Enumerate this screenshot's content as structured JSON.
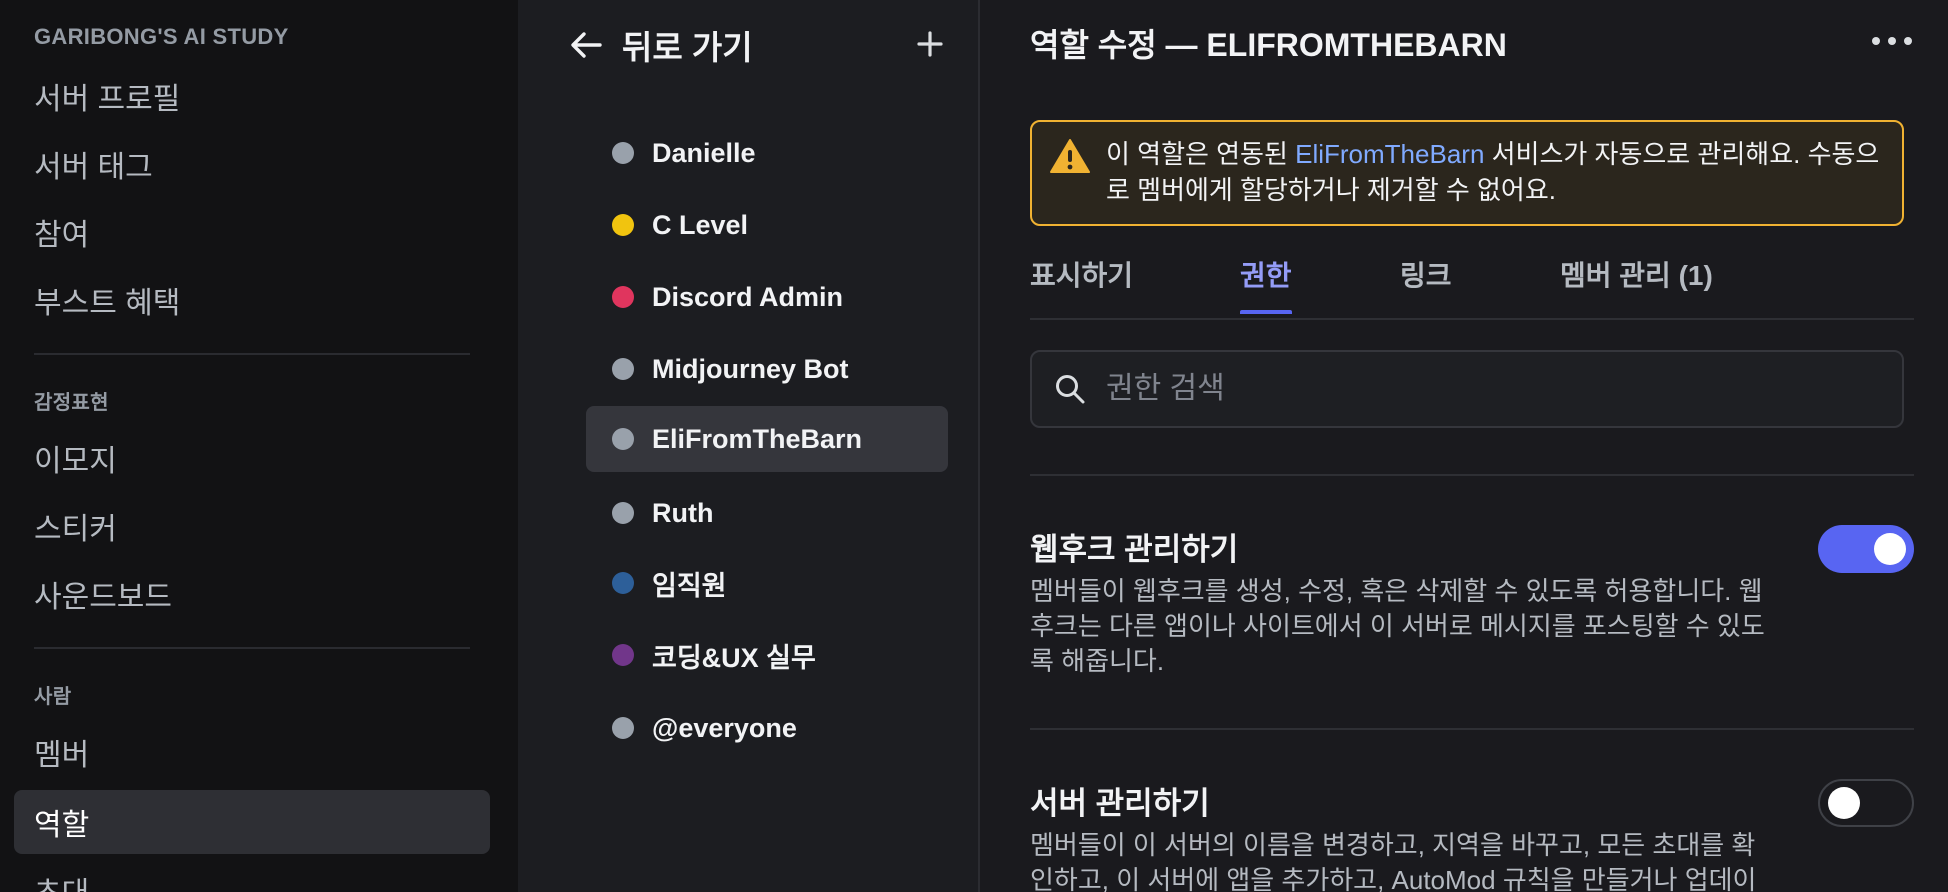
{
  "sidebar": {
    "server_name": "GARIBONG'S AI STUDY",
    "items_top": [
      "서버 프로필",
      "서버 태그",
      "참여",
      "부스트 혜택"
    ],
    "section_expression": "감정표현",
    "items_expression": [
      "이모지",
      "스티커",
      "사운드보드"
    ],
    "section_people": "사람",
    "items_people": [
      "멤버",
      "역할",
      "초대"
    ],
    "active_item": "역할"
  },
  "roles_panel": {
    "back_label": "뒤로 가기",
    "roles": [
      {
        "name": "Danielle",
        "color": "#99a1ab"
      },
      {
        "name": "C Level",
        "color": "#f1c40f"
      },
      {
        "name": "Discord Admin",
        "color": "#e0355e"
      },
      {
        "name": "Midjourney Bot",
        "color": "#99a1ab"
      },
      {
        "name": "EliFromTheBarn",
        "color": "#99a1ab"
      },
      {
        "name": "Ruth",
        "color": "#99a1ab"
      },
      {
        "name": "임직원",
        "color": "#2d5f99"
      },
      {
        "name": "코딩&UX 실무",
        "color": "#71368a"
      },
      {
        "name": "@everyone",
        "color": "#99a1ab"
      }
    ],
    "active_role": "EliFromTheBarn"
  },
  "main": {
    "title": "역할 수정 — ELIFROMTHEBARN",
    "notice": {
      "before": "이 역할은 연동된 ",
      "link": "EliFromTheBarn",
      "after": " 서비스가 자동으로 관리해요. 수동으로 멤버에게 할당하거나 제거할 수 없어요."
    },
    "tabs": [
      "표시하기",
      "권한",
      "링크",
      "멤버 관리 (1)"
    ],
    "active_tab": "권한",
    "search_placeholder": "권한 검색",
    "permissions": [
      {
        "title": "웹후크 관리하기",
        "description": "멤버들이 웹후크를 생성, 수정, 혹은 삭제할 수 있도록 허용합니다. 웹후크는 다른 앱이나 사이트에서 이 서버로 메시지를 포스팅할 수 있도록 해줍니다.",
        "enabled": true
      },
      {
        "title": "서버 관리하기",
        "description": "멤버들이 이 서버의 이름을 변경하고, 지역을 바꾸고, 모든 초대를 확인하고, 이 서버에 앱을 추가하고, AutoMod 규칙을 만들거나 업데이",
        "enabled": false
      }
    ]
  },
  "colors": {
    "accent": "#5865f2",
    "warning": "#f0b232",
    "link": "#80aaff"
  }
}
